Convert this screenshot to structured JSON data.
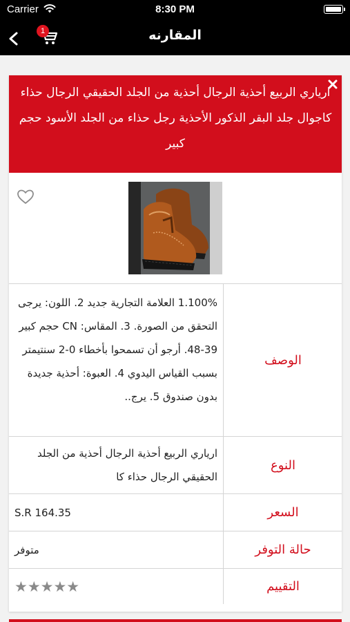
{
  "status_bar": {
    "carrier": "Carrier",
    "time": "8:30 PM",
    "wifi_icon": "wifi-icon",
    "battery_icon": "battery-full-icon"
  },
  "nav": {
    "title": "المقارنه",
    "back_icon": "chevron-left-icon",
    "cart_icon": "shopping-cart-icon",
    "cart_count": "1"
  },
  "product": {
    "title": "ارياري الربيع أحذية الرجال أحذية من الجلد الحقيقي الرجال حذاء كاجوال جلد البقر الذكور الأحذية رجل حذاء من الجلد الأسود حجم كبير",
    "close_icon": "close-icon",
    "favorite_icon": "heart-outline-icon",
    "image_icon": "boot-photo"
  },
  "specs": [
    {
      "label": "الوصف",
      "value": "1.100% العلامة التجارية جديد 2. اللون: يرجى التحقق من الصورة. 3. المقاس: CN حجم كبير 39-48. أرجو أن تسمحوا بأخطاء 0-2 سنتيمتر بسبب القياس اليدوي 4. العبوة: أحذية جديدة بدون صندوق 5. يرج.."
    },
    {
      "label": "النوع",
      "value": "ارياري الربيع أحذية الرجال أحذية من الجلد الحقيقي الرجال حذاء كا"
    },
    {
      "label": "السعر",
      "value": "S.R 164.35"
    },
    {
      "label": "حالة التوفر",
      "value": "متوفر"
    },
    {
      "label": "التقييم",
      "value": "★★★★★"
    }
  ],
  "colors": {
    "accent": "#d20e1c",
    "nav_background": "#000000",
    "page_background": "#f2f2f2"
  }
}
